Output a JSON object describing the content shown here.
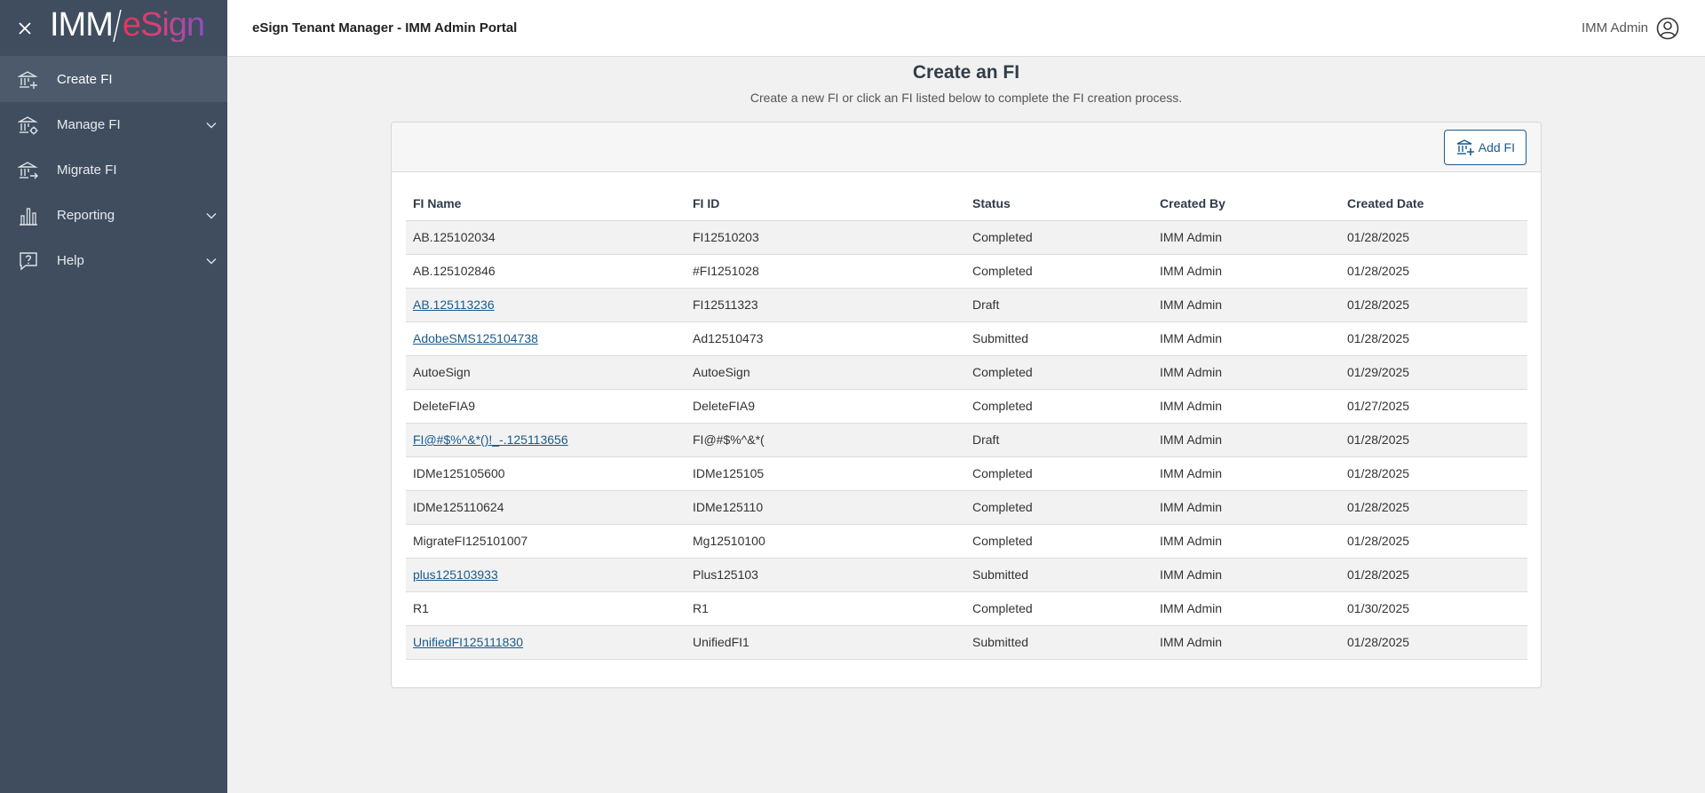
{
  "sidebar": {
    "logo": {
      "left": "IMM",
      "right": "eSign"
    },
    "items": [
      {
        "label": "Create FI",
        "icon": "bank-plus-icon",
        "expandable": false,
        "active": true
      },
      {
        "label": "Manage FI",
        "icon": "bank-gear-icon",
        "expandable": true,
        "active": false
      },
      {
        "label": "Migrate FI",
        "icon": "bank-arrow-icon",
        "expandable": false,
        "active": false
      },
      {
        "label": "Reporting",
        "icon": "bar-chart-icon",
        "expandable": true,
        "active": false
      },
      {
        "label": "Help",
        "icon": "help-icon",
        "expandable": true,
        "active": false
      }
    ]
  },
  "header": {
    "title": "eSign Tenant Manager - IMM Admin Portal",
    "user": "IMM Admin"
  },
  "main": {
    "title": "Create an FI",
    "subtitle": "Create a new FI or click an FI listed below to complete the FI creation process.",
    "add_button": "Add FI",
    "columns": [
      "FI Name",
      "FI ID",
      "Status",
      "Created By",
      "Created Date"
    ],
    "rows": [
      {
        "name": "AB.125102034",
        "id": "FI12510203",
        "status": "Completed",
        "created_by": "IMM Admin",
        "date": "01/28/2025",
        "link": false
      },
      {
        "name": "AB.125102846",
        "id": "#FI1251028",
        "status": "Completed",
        "created_by": "IMM Admin",
        "date": "01/28/2025",
        "link": false
      },
      {
        "name": "AB.125113236",
        "id": "FI12511323",
        "status": "Draft",
        "created_by": "IMM Admin",
        "date": "01/28/2025",
        "link": true
      },
      {
        "name": "AdobeSMS125104738",
        "id": "Ad12510473",
        "status": "Submitted",
        "created_by": "IMM Admin",
        "date": "01/28/2025",
        "link": true
      },
      {
        "name": "AutoeSign",
        "id": "AutoeSign",
        "status": "Completed",
        "created_by": "IMM Admin",
        "date": "01/29/2025",
        "link": false
      },
      {
        "name": "DeleteFIA9",
        "id": "DeleteFIA9",
        "status": "Completed",
        "created_by": "IMM Admin",
        "date": "01/27/2025",
        "link": false
      },
      {
        "name": "FI@#$%^&*()!_-.125113656",
        "id": "FI@#$%^&*(",
        "status": "Draft",
        "created_by": "IMM Admin",
        "date": "01/28/2025",
        "link": true
      },
      {
        "name": "IDMe125105600",
        "id": "IDMe125105",
        "status": "Completed",
        "created_by": "IMM Admin",
        "date": "01/28/2025",
        "link": false
      },
      {
        "name": "IDMe125110624",
        "id": "IDMe125110",
        "status": "Completed",
        "created_by": "IMM Admin",
        "date": "01/28/2025",
        "link": false
      },
      {
        "name": "MigrateFI125101007",
        "id": "Mg12510100",
        "status": "Completed",
        "created_by": "IMM Admin",
        "date": "01/28/2025",
        "link": false
      },
      {
        "name": "plus125103933",
        "id": "Plus125103",
        "status": "Submitted",
        "created_by": "IMM Admin",
        "date": "01/28/2025",
        "link": true
      },
      {
        "name": "R1",
        "id": "R1",
        "status": "Completed",
        "created_by": "IMM Admin",
        "date": "01/30/2025",
        "link": false
      },
      {
        "name": "UnifiedFI125111830",
        "id": "UnifiedFI1",
        "status": "Submitted",
        "created_by": "IMM Admin",
        "date": "01/28/2025",
        "link": true
      }
    ]
  },
  "colors": {
    "sidebar_bg": "#3f4d5f",
    "sidebar_active": "#4c5a6c",
    "link": "#1b5a8c",
    "page_bg": "#f1f1f1"
  }
}
